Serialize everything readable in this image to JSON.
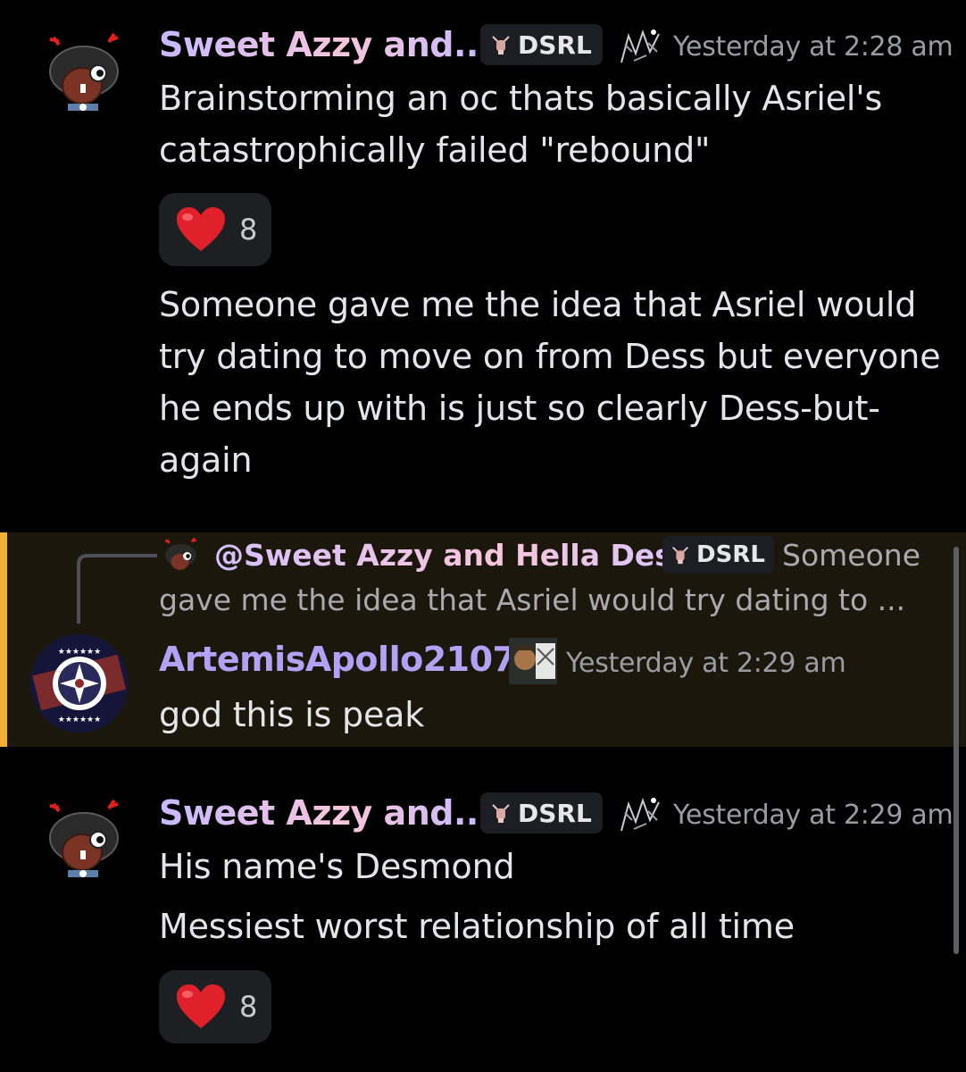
{
  "messages": [
    {
      "author": "Sweet Azzy and...",
      "tag": "DSRL",
      "timestamp": "Yesterday at 2:28 am",
      "text": [
        "Brainstorming an oc thats basically Asriel's",
        "catastrophically failed \"rebound\""
      ],
      "reaction": {
        "emoji": "heart-emoji",
        "count": "8"
      },
      "followup": [
        "Someone gave me the idea that Asriel would",
        "try dating to move on from Dess but everyone",
        "he ends up with is just so clearly Dess-but-",
        "again"
      ]
    },
    {
      "reply_to": {
        "mention": "@Sweet Azzy and Hella Dess",
        "tag": "DSRL",
        "snippet_1": "Someone",
        "snippet_2": "gave me the idea that Asriel would try dating to ..."
      },
      "author": "ArtemisApollo2107",
      "timestamp": "Yesterday at 2:29 am",
      "text": "god this is peak",
      "highlight_color": "#f0b132"
    },
    {
      "author": "Sweet Azzy and...",
      "tag": "DSRL",
      "timestamp": "Yesterday at 2:29 am",
      "text": "His name's Desmond",
      "followup": "Messiest worst relationship of all time",
      "reaction": {
        "emoji": "heart-emoji",
        "count": "8"
      }
    }
  ]
}
